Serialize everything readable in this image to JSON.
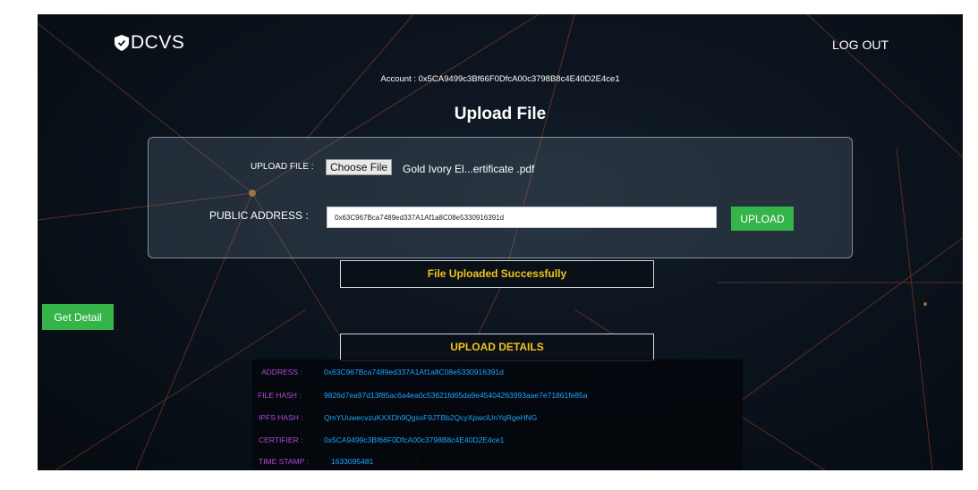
{
  "brand": {
    "name": "DCVS"
  },
  "header": {
    "logout_label": "LOG OUT"
  },
  "account": {
    "text": "Account : 0x5CA9499c3Bf66F0DfcA00c3798B8c4E40D2E4ce1"
  },
  "page_title": "Upload File",
  "upload_form": {
    "file_label": "UPLOAD FILE :",
    "choose_file_label": "Choose File",
    "file_name": "Gold Ivory El...ertificate .pdf",
    "public_address_label": "PUBLIC ADDRESS :",
    "public_address_value": "0x63C967Bca7489ed337A1Af1a8C08e5330916391d",
    "upload_button": "UPLOAD"
  },
  "status_message": "File Uploaded Successfully",
  "get_detail_button": "Get Detail",
  "details": {
    "heading": "UPLOAD DETAILS",
    "rows": [
      {
        "label": "ADDRESS :",
        "value": "0x63C967Bca7489ed337A1Af1a8C08e5330916391d"
      },
      {
        "label": "FILE HASH :",
        "value": "9826d7ea97d13f85ac6a4ea0c53621fd65da9e45404263993aae7e71861fe85a"
      },
      {
        "label": "IPFS HASH :",
        "value": "QmYUuwecvzuKXXDh9QgsxF9JTBb2QcyXpwciUnYqRgeHNG"
      },
      {
        "label": "CERTIFIER :",
        "value": "0x5CA9499c3Bf66F0DfcA00c3798B8c4E40D2E4ce1"
      },
      {
        "label": "TIME STAMP :",
        "value": "1633095481"
      }
    ]
  },
  "colors": {
    "accent_green": "#35b44a",
    "status_yellow": "#f2c21b",
    "detail_label": "#b04ad6",
    "detail_value": "#1ea7ff",
    "background": "#0a121b"
  },
  "icons": {
    "logo": "shield-check-icon"
  }
}
